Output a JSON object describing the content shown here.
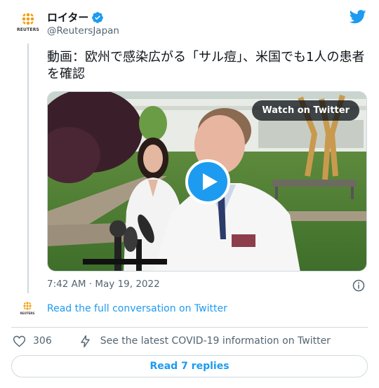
{
  "author": {
    "display_name": "ロイター",
    "handle": "@ReutersJapan",
    "avatar_wordmark": "REUTERS"
  },
  "tweet": {
    "text": "動画：欧州で感染広がる「サル痘」、米国でも1人の患者を確認",
    "timestamp": "7:42 AM · May 19, 2022"
  },
  "media": {
    "watch_label": "Watch on Twitter"
  },
  "conversation": {
    "link_label": "Read the full conversation on Twitter"
  },
  "actions": {
    "like_count": "306",
    "covid_label": "See the latest COVID-19 information on Twitter"
  },
  "replies": {
    "label": "Read 7 replies"
  },
  "colors": {
    "accent": "#1d9bf0",
    "muted": "#536471",
    "border": "#cfd9de"
  }
}
